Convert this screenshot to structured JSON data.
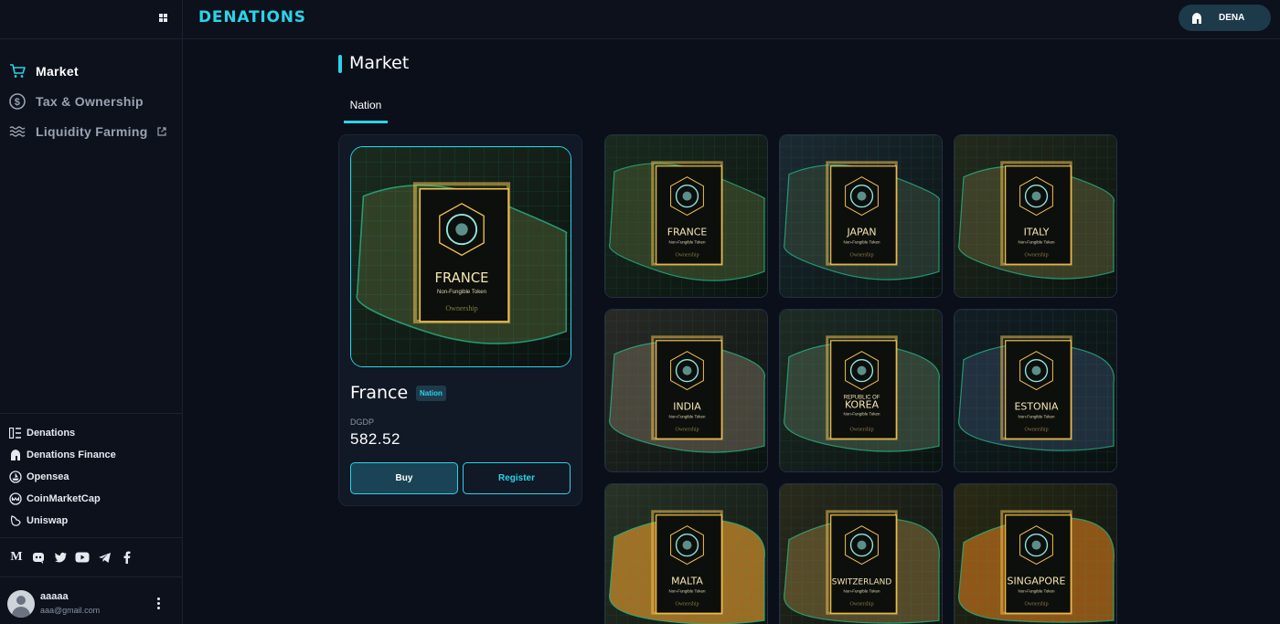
{
  "topbar": {
    "logo": "DENATIONS",
    "wallet_label": "DENA"
  },
  "sidebar": {
    "nav": [
      {
        "label": "Market",
        "icon": "cart-icon",
        "active": true
      },
      {
        "label": "Tax & Ownership",
        "icon": "dollar-circle-icon"
      },
      {
        "label": "Liquidity Farming",
        "icon": "waves-icon",
        "external": true
      }
    ],
    "links": [
      {
        "label": "Denations",
        "icon": "denations-icon"
      },
      {
        "label": "Denations Finance",
        "icon": "spartan-helmet-icon"
      },
      {
        "label": "Opensea",
        "icon": "opensea-icon"
      },
      {
        "label": "CoinMarketCap",
        "icon": "coinmarketcap-icon"
      },
      {
        "label": "Uniswap",
        "icon": "uniswap-icon"
      }
    ],
    "socials": [
      "medium-icon",
      "discord-icon",
      "twitter-icon",
      "youtube-icon",
      "telegram-icon",
      "facebook-icon"
    ],
    "user": {
      "name": "aaaaa",
      "email": "aaa@gmail.com"
    }
  },
  "main": {
    "title": "Market",
    "tabs": [
      {
        "label": "Nation",
        "active": true
      }
    ],
    "detail": {
      "name": "France",
      "badge": "Nation",
      "card_country": "FRANCE",
      "card_subtitle": "Non-Fungible Token",
      "card_script": "Ownership",
      "metric_label": "DGDP",
      "metric_value": "582.52",
      "buy_label": "Buy",
      "register_label": "Register"
    },
    "nations": [
      {
        "name": "FRANCE",
        "subtitle": "Non-Fungible Token",
        "script": "Ownership"
      },
      {
        "name": "JAPAN",
        "subtitle": "Non-Fungible Token",
        "script": "Ownership"
      },
      {
        "name": "ITALY",
        "subtitle": "Non-Fungible Token",
        "script": "Ownership"
      },
      {
        "name": "INDIA",
        "subtitle": "Non-Fungible Token",
        "script": "Ownership"
      },
      {
        "name": "KOREA",
        "pre_name": "REPUBLIC OF",
        "subtitle": "Non-Fungible Token",
        "script": "Ownership"
      },
      {
        "name": "ESTONIA",
        "subtitle": "Non-Fungible Token",
        "script": "Ownership"
      },
      {
        "name": "MALTA",
        "subtitle": "Non-Fungible Token",
        "script": "Ownership"
      },
      {
        "name": "SWITZERLAND",
        "subtitle": "Non-Fungible Token",
        "script": "Ownership"
      },
      {
        "name": "SINGAPORE",
        "subtitle": "Non-Fungible Token",
        "script": "Ownership"
      }
    ]
  },
  "colors": {
    "accent": "#2bd3e8",
    "background": "#0b0f1a",
    "panel": "#111826",
    "gold": "#f2c14e"
  }
}
